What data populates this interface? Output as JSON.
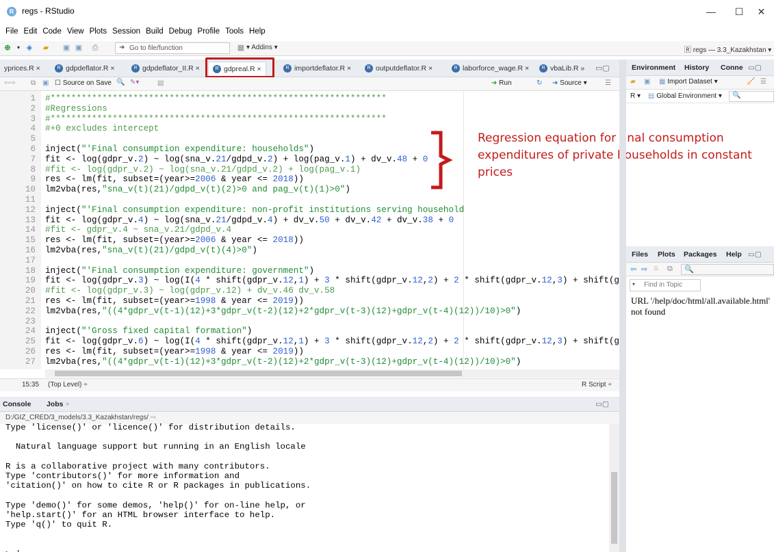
{
  "window": {
    "title": "regs - RStudio",
    "app_icon": "R",
    "min": "—",
    "max": "☐",
    "close": "✕"
  },
  "menu": [
    "File",
    "Edit",
    "Code",
    "View",
    "Plots",
    "Session",
    "Build",
    "Debug",
    "Profile",
    "Tools",
    "Help"
  ],
  "toolbar": {
    "goto_placeholder": "Go to file/function",
    "addins": "Addins",
    "project": "regs — 3.3_Kazakhstan"
  },
  "editor_tabs": [
    "yprices.R",
    "gdpdeflator.R",
    "gdpdeflator_II.R",
    "gdpreal.R",
    "importdeflator.R",
    "outputdeflator.R",
    "laborforce_wage.R",
    "vbaLib.R"
  ],
  "editor_toolbar": {
    "source_on_save": "Source on Save",
    "run": "Run",
    "source": "Source"
  },
  "code_lines": [
    {
      "n": "1",
      "t": "#*****************************************************************",
      "c": "cm"
    },
    {
      "n": "2",
      "t": "#Regressions",
      "c": "cm"
    },
    {
      "n": "3",
      "t": "#*****************************************************************",
      "c": "cm"
    },
    {
      "n": "4",
      "t": "#+0 excludes intercept",
      "c": "cm"
    },
    {
      "n": "5",
      "t": "",
      "c": ""
    },
    {
      "n": "6",
      "t": "inject(\"'Final consumption expenditure: households\")",
      "c": ""
    },
    {
      "n": "7",
      "t": "fit <- log(gdpr_v.2) ~ log(sna_v.21/gdpd_v.2) + log(pag_v.1) + dv_v.48 + 0",
      "c": ""
    },
    {
      "n": "8",
      "t": "#fit <- log(gdpr_v.2) ~ log(sna_v.21/gdpd_v.2) + log(pag_v.1)",
      "c": "cm"
    },
    {
      "n": "9",
      "t": "res <- lm(fit, subset=(year>=2006 & year <= 2018))",
      "c": ""
    },
    {
      "n": "10",
      "t": "lm2vba(res,\"sna_v(t)(21)/gdpd_v(t)(2)>0 and pag_v(t)(1)>0\")",
      "c": ""
    },
    {
      "n": "11",
      "t": "",
      "c": ""
    },
    {
      "n": "12",
      "t": "inject(\"'Final consumption expenditure: non-profit institutions serving household",
      "c": ""
    },
    {
      "n": "13",
      "t": "fit <- log(gdpr_v.4) ~ log(sna_v.21/gdpd_v.4) + dv_v.50 + dv_v.42 + dv_v.38 + 0",
      "c": ""
    },
    {
      "n": "14",
      "t": "#fit <- gdpr_v.4 ~ sna_v.21/gdpd_v.4",
      "c": "cm"
    },
    {
      "n": "15",
      "t": "res <- lm(fit, subset=(year>=2006 & year <= 2018))",
      "c": ""
    },
    {
      "n": "16",
      "t": "lm2vba(res,\"sna_v(t)(21)/gdpd_v(t)(4)>0\")",
      "c": ""
    },
    {
      "n": "17",
      "t": "",
      "c": ""
    },
    {
      "n": "18",
      "t": "inject(\"'Final consumption expenditure: government\")",
      "c": ""
    },
    {
      "n": "19",
      "t": "fit <- log(gdpr_v.3) ~ log(I(4 * shift(gdpr_v.12,1) + 3 * shift(gdpr_v.12,2) + 2 * shift(gdpr_v.12,3) + shift(g",
      "c": ""
    },
    {
      "n": "20",
      "t": "#fit <- log(gdpr_v.3) ~ log(gdpr_v.12) + dv_v.46 dv_v.58",
      "c": "cm"
    },
    {
      "n": "21",
      "t": "res <- lm(fit, subset=(year>=1998 & year <= 2019))",
      "c": ""
    },
    {
      "n": "22",
      "t": "lm2vba(res,\"((4*gdpr_v(t-1)(12)+3*gdpr_v(t-2)(12)+2*gdpr_v(t-3)(12)+gdpr_v(t-4)(12))/10)>0\")",
      "c": ""
    },
    {
      "n": "23",
      "t": "",
      "c": ""
    },
    {
      "n": "24",
      "t": "inject(\"'Gross fixed capital formation\")",
      "c": ""
    },
    {
      "n": "25",
      "t": "fit <- log(gdpr_v.6) ~ log(I(4 * shift(gdpr_v.12,1) + 3 * shift(gdpr_v.12,2) + 2 * shift(gdpr_v.12,3) + shift(g",
      "c": ""
    },
    {
      "n": "26",
      "t": "res <- lm(fit, subset=(year>=1998 & year <= 2019))",
      "c": ""
    },
    {
      "n": "27",
      "t": "lm2vba(res,\"((4*gdpr_v(t-1)(12)+3*gdpr_v(t-2)(12)+2*gdpr_v(t-3)(12)+gdpr_v(t-4)(12))/10)>0\")",
      "c": ""
    }
  ],
  "annotation": "Regression equation for final consumption expenditures of private households in constant prices",
  "editor_status": {
    "position": "15:35",
    "scope": "(Top Level) ÷",
    "filetype": "R Script ÷"
  },
  "console_tabs": [
    "Console",
    "Jobs"
  ],
  "console_path": "D:/GIZ_CRED/3_models/3.3_Kazakhstan/regs/",
  "console_lines": [
    "Type 'license()' or 'licence()' for distribution details.",
    "",
    "  Natural language support but running in an English locale",
    "",
    "R is a collaborative project with many contributors.",
    "Type 'contributors()' for more information and",
    "'citation()' on how to cite R or R packages in publications.",
    "",
    "Type 'demo()' for some demos, 'help()' for on-line help, or",
    "'help.start()' for an HTML browser interface to help.",
    "Type 'q()' to quit R.",
    "",
    "",
    "> |"
  ],
  "env_tabs": [
    "Environment",
    "History",
    "Conne"
  ],
  "env_toolbar": {
    "import": "Import Dataset",
    "lang": "R",
    "scope": "Global Environment"
  },
  "files_tabs": [
    "Files",
    "Plots",
    "Packages",
    "Help"
  ],
  "find_topic": "Find in Topic",
  "help_text": "URL '/help/doc/html/all.available.html' not found"
}
